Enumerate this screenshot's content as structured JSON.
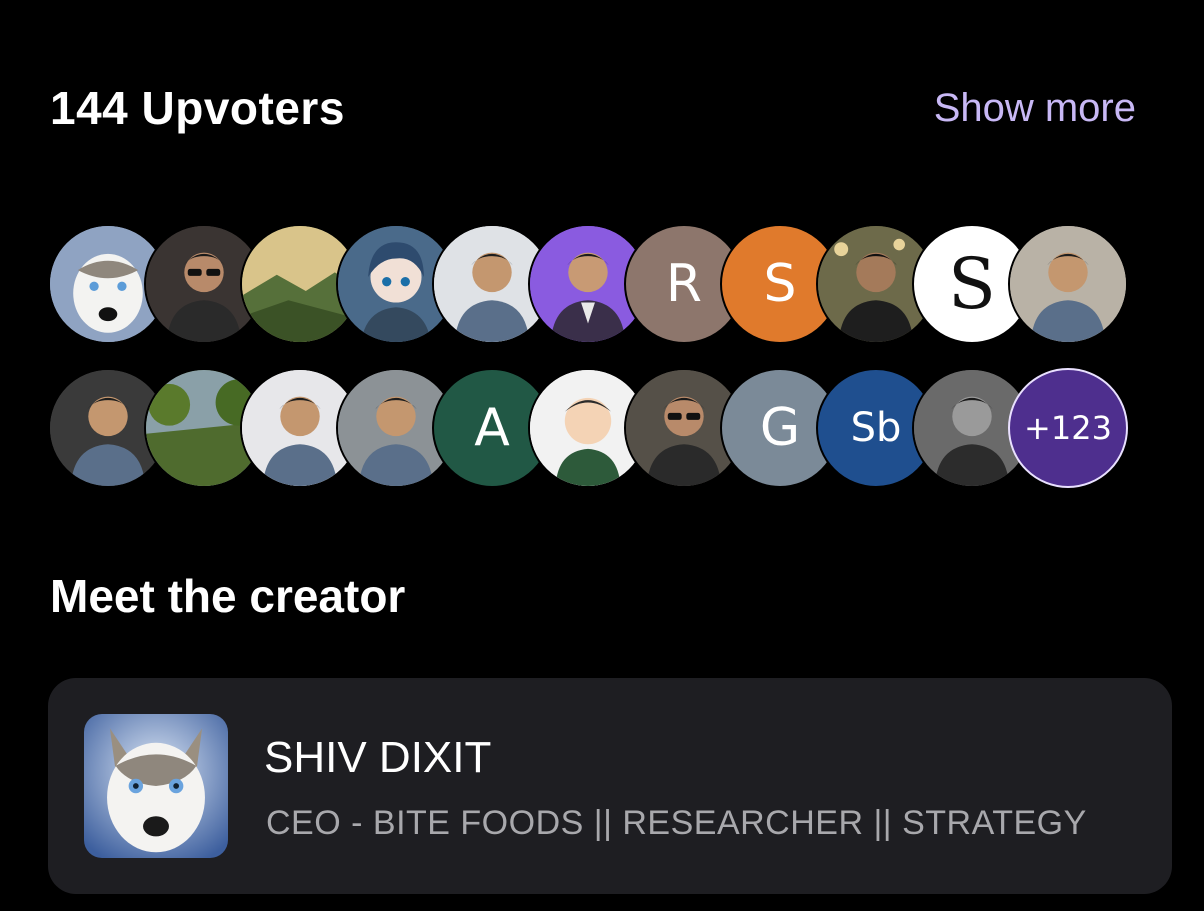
{
  "header": {
    "title": "144 Upvoters",
    "show_more": "Show more"
  },
  "upvoters": {
    "row1": [
      {
        "kind": "photo",
        "icon": "husky-photo-icon",
        "bg": "#8fa3c2"
      },
      {
        "kind": "photo",
        "icon": "person-sunglasses-photo-icon",
        "bg": "#3a3432"
      },
      {
        "kind": "photo",
        "icon": "landscape-sunset-photo-icon",
        "bg": "#7a8a55"
      },
      {
        "kind": "photo",
        "icon": "anime-girl-photo-icon",
        "bg": "#4a6a8a"
      },
      {
        "kind": "photo",
        "icon": "person-shirt-photo-icon",
        "bg": "#dfe2e6"
      },
      {
        "kind": "photo",
        "icon": "person-suit-photo-icon",
        "bg": "#8a5be0"
      },
      {
        "kind": "initial",
        "text": "R",
        "bg": "#8d766c"
      },
      {
        "kind": "initial",
        "text": "S",
        "bg": "#e07a2c"
      },
      {
        "kind": "photo",
        "icon": "person-cafe-photo-icon",
        "bg": "#5a5a3a"
      },
      {
        "kind": "initial-serif",
        "text": "S",
        "bg": "#ffffff",
        "fg": "#111111"
      },
      {
        "kind": "photo",
        "icon": "young-man-photo-icon",
        "bg": "#b9b2a6"
      }
    ],
    "row2": [
      {
        "kind": "photo",
        "icon": "man-gym-photo-icon",
        "bg": "#3a3a3a"
      },
      {
        "kind": "photo",
        "icon": "forest-photo-icon",
        "bg": "#4f6b2e"
      },
      {
        "kind": "photo",
        "icon": "smiling-man-photo-icon",
        "bg": "#e7e7ea"
      },
      {
        "kind": "photo",
        "icon": "bearded-man-photo-icon",
        "bg": "#8c9296"
      },
      {
        "kind": "initial",
        "text": "A",
        "bg": "#215845"
      },
      {
        "kind": "photo",
        "icon": "cartoon-avatar-photo-icon",
        "bg": "#f2f2f2"
      },
      {
        "kind": "photo",
        "icon": "man-sunglasses-photo-icon",
        "bg": "#555048"
      },
      {
        "kind": "initial",
        "text": "G",
        "bg": "#7b8a98"
      },
      {
        "kind": "initial",
        "text": "Sb",
        "bg": "#1f4f8f"
      },
      {
        "kind": "photo",
        "icon": "man-bw-photo-icon",
        "bg": "#555555"
      },
      {
        "kind": "more",
        "text": "+123",
        "bg": "#4e2f8e"
      }
    ]
  },
  "creator_section": {
    "title": "Meet the creator"
  },
  "creator": {
    "name": "SHIV DIXIT",
    "role": "CEO - BITE FOODS || RESEARCHER || STRATEGY",
    "photo_icon": "husky-photo-icon"
  }
}
